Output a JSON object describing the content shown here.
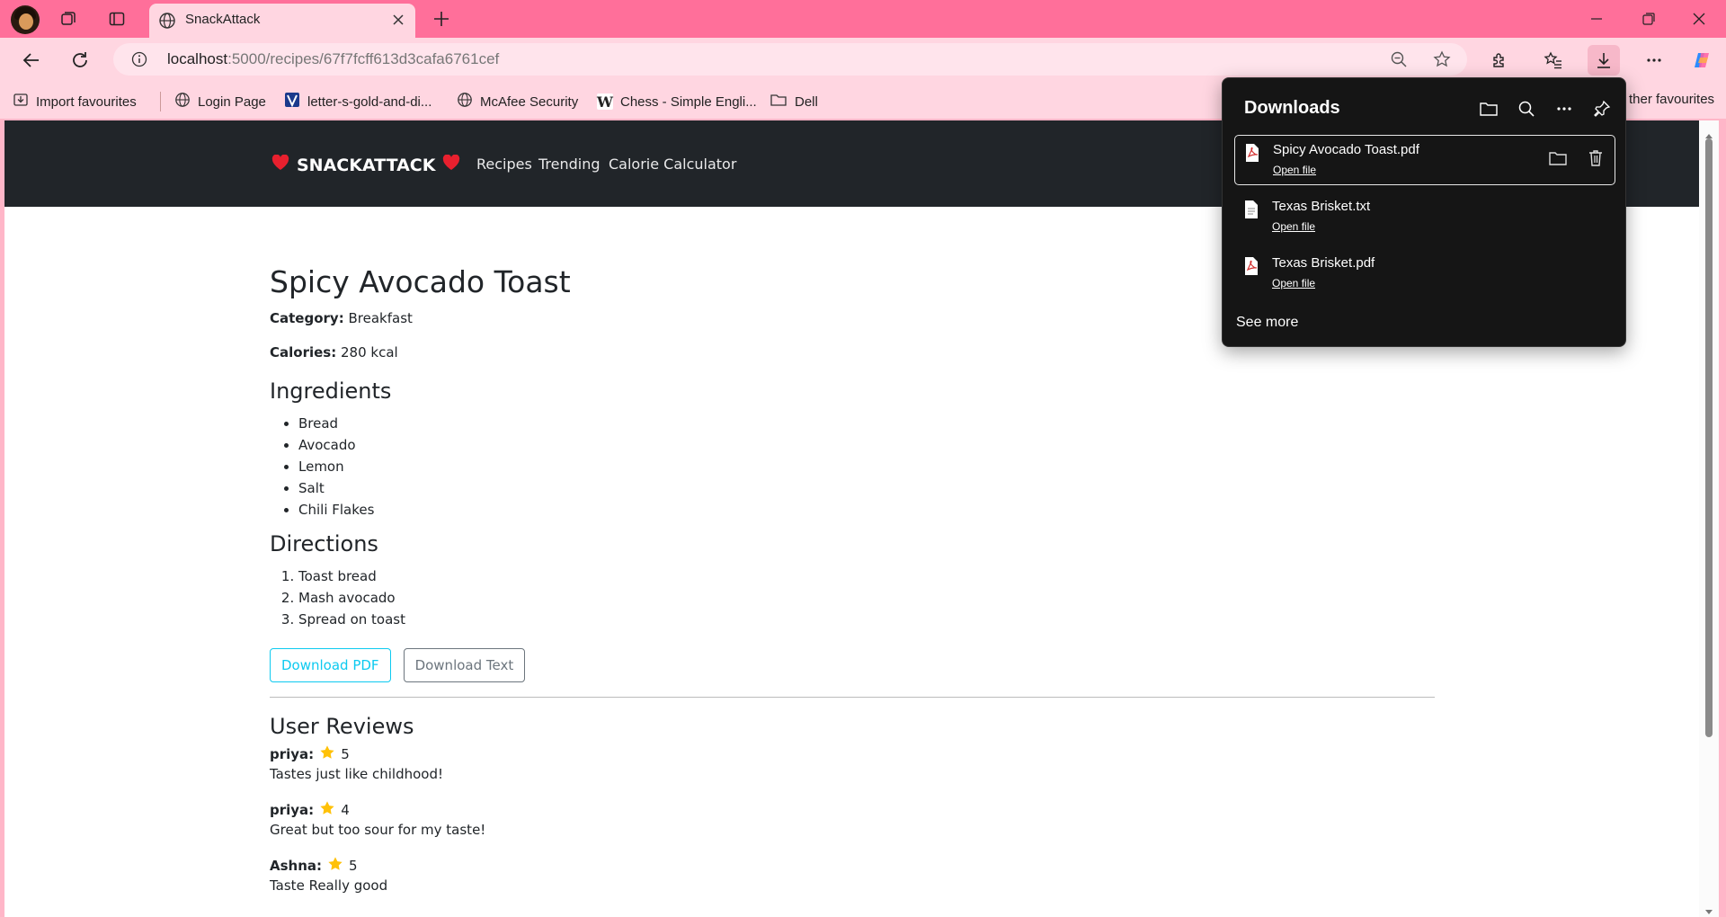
{
  "browser": {
    "tab": {
      "title": "SnackAttack"
    },
    "address": {
      "host": "localhost",
      "path": ":5000/recipes/67f7fcff613d3cafa6761cef"
    },
    "bookmarks": [
      {
        "label": "Import favourites",
        "icon": "import-icon"
      },
      {
        "label": "Login Page",
        "icon": "globe-icon"
      },
      {
        "label": "letter-s-gold-and-di...",
        "icon": "v-logo-icon"
      },
      {
        "label": "McAfee Security",
        "icon": "globe-icon"
      },
      {
        "label": "Chess - Simple Engli...",
        "icon": "wikipedia-icon"
      },
      {
        "label": "Dell",
        "icon": "folder-icon"
      }
    ],
    "other_favourites_fragment": "ther favourites"
  },
  "site": {
    "brand": "SNACKATTACK",
    "nav": [
      "Recipes",
      "Trending",
      "Calorie Calculator"
    ]
  },
  "recipe": {
    "title": "Spicy Avocado Toast",
    "category_label": "Category:",
    "category": "Breakfast",
    "calories_label": "Calories:",
    "calories": "280 kcal",
    "ingredients_heading": "Ingredients",
    "ingredients": [
      "Bread",
      "Avocado",
      "Lemon",
      "Salt",
      "Chili Flakes"
    ],
    "directions_heading": "Directions",
    "directions": [
      "Toast bread",
      "Mash avocado",
      "Spread on toast"
    ],
    "download_pdf": "Download PDF",
    "download_text": "Download Text"
  },
  "reviews": {
    "heading": "User Reviews",
    "items": [
      {
        "user": "priya:",
        "rating": "5",
        "text": "Tastes just like childhood!"
      },
      {
        "user": "priya:",
        "rating": "4",
        "text": "Great but too sour for my taste!"
      },
      {
        "user": "Ashna:",
        "rating": "5",
        "text": "Taste Really good"
      }
    ]
  },
  "downloads": {
    "title": "Downloads",
    "items": [
      {
        "name": "Spicy Avocado Toast.pdf",
        "action": "Open file",
        "type": "pdf-file-icon"
      },
      {
        "name": "Texas Brisket.txt",
        "action": "Open file",
        "type": "text-file-icon"
      },
      {
        "name": "Texas Brisket.pdf",
        "action": "Open file",
        "type": "pdf-file-icon"
      }
    ],
    "see_more": "See more"
  },
  "colors": {
    "tabstrip": "#ff6f9a",
    "toolbar": "#ffd6e1",
    "site_nav": "#212529",
    "accent_info": "#0dcaf0",
    "star": "#ffc107"
  }
}
